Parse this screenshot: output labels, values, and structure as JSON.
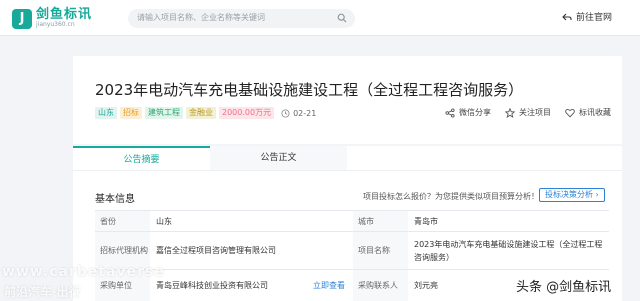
{
  "brand": {
    "name": "剑鱼标讯",
    "sub": "jianyu360.cn",
    "mark": "J"
  },
  "search": {
    "placeholder": "请输入项目名称、企业名称等关键词"
  },
  "nav": {
    "official_site": "前往官网"
  },
  "project": {
    "title": "2023年电动汽车充电基础设施建设工程（全过程工程咨询服务）",
    "tags": {
      "region": "山东",
      "stage": "招标",
      "industry": "建筑工程",
      "finance": "金融业",
      "amount": "2000.00万元"
    },
    "date": "02-21",
    "actions": {
      "share": "微信分享",
      "follow": "关注项目",
      "collect": "标讯收藏"
    }
  },
  "tabs": {
    "summary": "公告摘要",
    "full_text": "公告正文"
  },
  "basic_info": {
    "title": "基本信息",
    "budget_question": "项目投标怎么报价？为您提供类似项目预算分析！",
    "budget_button": "投标决策分析 ›",
    "rows": {
      "province_label": "省份",
      "province": "山东",
      "city_label": "城市",
      "city": "青岛市",
      "agency_label": "招标代理机构",
      "agency": "嘉信全过程项目咨询管理有限公司",
      "project_name_label": "项目名称",
      "project_name": "2023年电动汽车充电基础设施建设工程（全过程工程咨询服务）",
      "buyer_label": "采购单位",
      "buyer": "青岛豆峰科技创业投资有限公司",
      "buyer_link": "立即查看",
      "contact_label": "采购联系人",
      "contact": "刘元亮"
    }
  },
  "watermarks": {
    "left_top": "www.carbetaverse",
    "left_bottom": "前沿汽车·出行",
    "right": "头条 @剑鱼标讯"
  },
  "colors": {
    "accent": "#17a99a",
    "link": "#2d82d6",
    "page_bg": "#f2f4f7"
  }
}
